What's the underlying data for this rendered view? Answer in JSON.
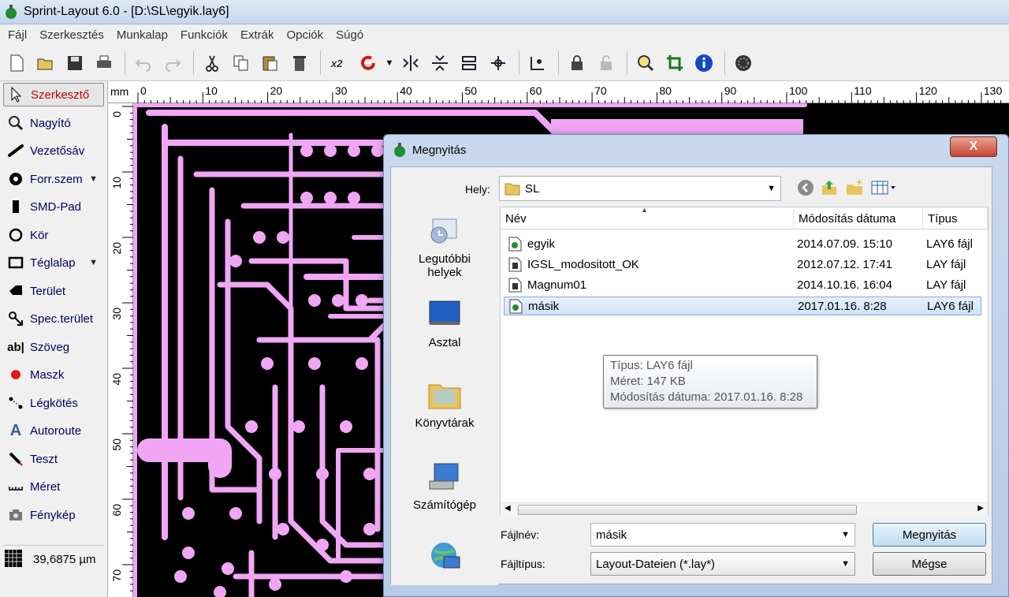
{
  "app": {
    "title": "Sprint-Layout 6.0 - [D:\\SL\\egyik.lay6]"
  },
  "menu": [
    "Fájl",
    "Szerkesztés",
    "Munkalap",
    "Funkciók",
    "Extrák",
    "Opciók",
    "Súgó"
  ],
  "toolbar": {
    "icons": [
      "new-icon",
      "open-icon",
      "save-icon",
      "print-icon",
      "undo-icon",
      "redo-icon",
      "cut-icon",
      "copy-icon",
      "paste-icon",
      "delete-icon",
      "duplicate-x2-icon",
      "rotate-icon",
      "mirror-h-icon",
      "mirror-v-icon",
      "align-icon",
      "group-icon",
      "ungroup-icon",
      "lock-icon",
      "unlock-icon",
      "zoom-icon",
      "crop-icon",
      "info-icon",
      "component-icon"
    ],
    "duplicate_label": "x2"
  },
  "tools": [
    {
      "label": "Szerkesztő",
      "icon": "cursor-icon",
      "active": true,
      "dropdown": false
    },
    {
      "label": "Nagyító",
      "icon": "magnifier-icon",
      "active": false,
      "dropdown": false
    },
    {
      "label": "Vezetősáv",
      "icon": "track-icon",
      "active": false,
      "dropdown": false
    },
    {
      "label": "Forr.szem",
      "icon": "pad-icon",
      "active": false,
      "dropdown": true
    },
    {
      "label": "SMD-Pad",
      "icon": "smd-pad-icon",
      "active": false,
      "dropdown": false
    },
    {
      "label": "Kör",
      "icon": "circle-icon",
      "active": false,
      "dropdown": false
    },
    {
      "label": "Téglalap",
      "icon": "rectangle-icon",
      "active": false,
      "dropdown": true
    },
    {
      "label": "Terület",
      "icon": "area-icon",
      "active": false,
      "dropdown": false
    },
    {
      "label": "Spec.terület",
      "icon": "special-area-icon",
      "active": false,
      "dropdown": false
    },
    {
      "label": "Szöveg",
      "icon": "text-icon",
      "active": false,
      "dropdown": false
    },
    {
      "label": "Maszk",
      "icon": "mask-icon",
      "active": false,
      "dropdown": false
    },
    {
      "label": "Légkötés",
      "icon": "airwire-icon",
      "active": false,
      "dropdown": false
    },
    {
      "label": "Autoroute",
      "icon": "autoroute-icon",
      "active": false,
      "dropdown": false
    },
    {
      "label": "Teszt",
      "icon": "test-icon",
      "active": false,
      "dropdown": false
    },
    {
      "label": "Méret",
      "icon": "measure-icon",
      "active": false,
      "dropdown": false
    },
    {
      "label": "Fénykép",
      "icon": "photo-icon",
      "active": false,
      "dropdown": false
    }
  ],
  "grid": {
    "value": "39,6875 µm"
  },
  "ruler": {
    "unit": "mm",
    "h_ticks": [
      "0",
      "10",
      "20",
      "30",
      "40",
      "50",
      "60",
      "70",
      "80",
      "90",
      "100",
      "110",
      "120",
      "130"
    ],
    "v_ticks": [
      "0",
      "10",
      "20",
      "30",
      "40",
      "50",
      "60",
      "70"
    ]
  },
  "colors": {
    "board": "#f0a6f5",
    "canvas": "#000000",
    "selection": "#cfe3f7"
  },
  "dialog": {
    "title": "Megnyitás",
    "close_label": "X",
    "location_label": "Hely:",
    "location_value": "SL",
    "places": [
      {
        "label": "Legutóbbi helyek",
        "icon": "recent-places-icon"
      },
      {
        "label": "Asztal",
        "icon": "desktop-icon"
      },
      {
        "label": "Könyvtárak",
        "icon": "libraries-icon"
      },
      {
        "label": "Számítógép",
        "icon": "computer-icon"
      },
      {
        "label": "",
        "icon": "network-icon"
      }
    ],
    "columns": [
      "Név",
      "Módosítás dátuma",
      "Típus"
    ],
    "files": [
      {
        "name": "egyik",
        "date": "2014.07.09. 15:10",
        "type": "LAY6 fájl",
        "selected": false,
        "icon": "lay6-file-icon"
      },
      {
        "name": "IGSL_modositott_OK",
        "date": "2012.07.12. 17:41",
        "type": "LAY fájl",
        "selected": false,
        "icon": "lay-file-icon"
      },
      {
        "name": "Magnum01",
        "date": "2014.10.16. 16:04",
        "type": "LAY fájl",
        "selected": false,
        "icon": "lay-file-icon"
      },
      {
        "name": "másik",
        "date": "2017.01.16. 8:28",
        "type": "LAY6 fájl",
        "selected": true,
        "icon": "lay6-file-icon"
      }
    ],
    "tooltip": {
      "type_line": "Típus: LAY6 fájl",
      "size_line": "Méret: 147 KB",
      "date_line": "Módosítás dátuma: 2017.01.16. 8:28"
    },
    "filename_label": "Fájlnév:",
    "filename_value": "másik",
    "filetype_label": "Fájltípus:",
    "filetype_value": "Layout-Dateien (*.lay*)",
    "open_button": "Megnyitás",
    "cancel_button": "Mégse"
  }
}
